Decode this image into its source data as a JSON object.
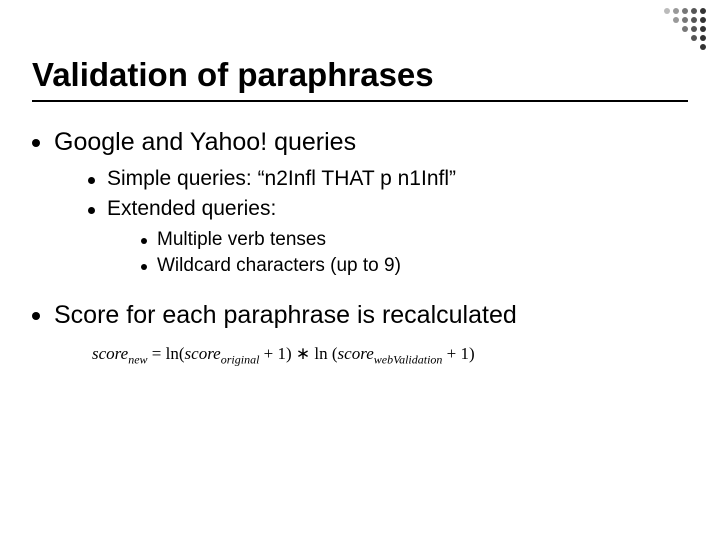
{
  "title": "Validation of paraphrases",
  "bullets": {
    "b1": "Google and Yahoo! queries",
    "b1_1": "Simple queries: “n2Infl THAT p n1Infl”",
    "b1_2": "Extended queries:",
    "b1_2_1": "Multiple verb tenses",
    "b1_2_2": "Wildcard characters (up to 9)",
    "b2": "Score for each paraphrase is recalculated"
  },
  "formula": {
    "lhs_var": "score",
    "lhs_sub": "new",
    "eq": " = ln(",
    "t1_var": "score",
    "t1_sub": "original",
    "mid1": " + 1) ∗ ln (",
    "t2_var": "score",
    "t2_sub": "webValidation",
    "tail": " + 1)"
  }
}
